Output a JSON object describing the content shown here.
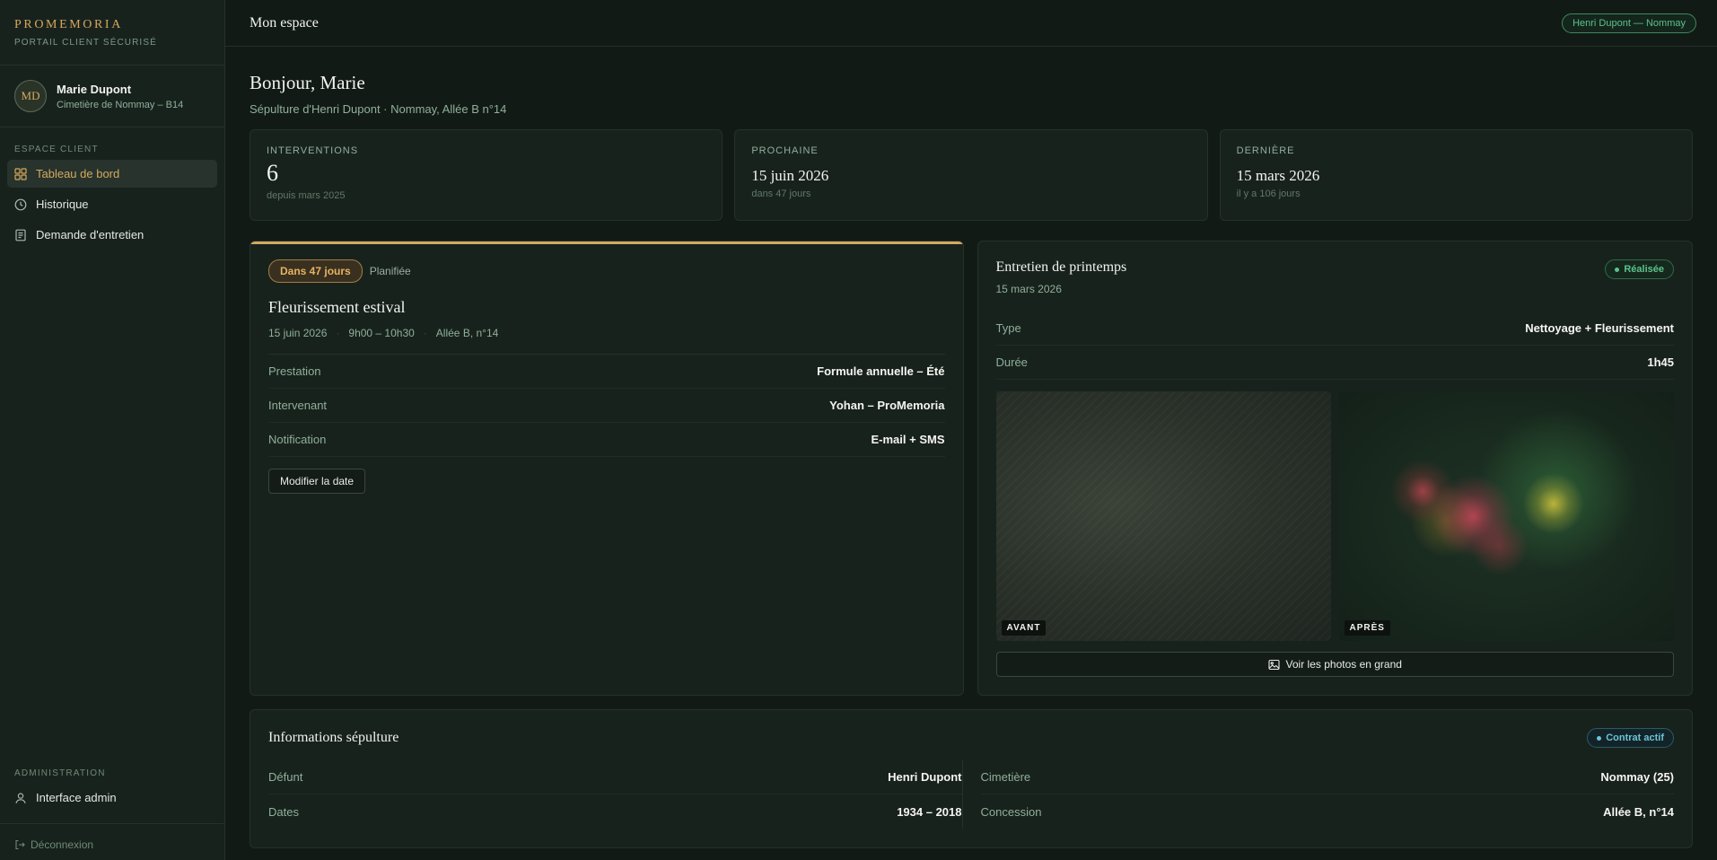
{
  "sidebar": {
    "brand": "PROMEMORIA",
    "brand_sub": "PORTAIL CLIENT SÉCURISÉ",
    "user": {
      "initials": "MD",
      "name": "Marie Dupont",
      "location": "Cimetière de Nommay – B14"
    },
    "section_client": "ESPACE CLIENT",
    "items": [
      {
        "label": "Tableau de bord",
        "icon": "grid-icon",
        "active": true
      },
      {
        "label": "Historique",
        "icon": "clock-icon"
      },
      {
        "label": "Demande d'entretien",
        "icon": "document-icon"
      }
    ],
    "section_admin": "ADMINISTRATION",
    "admin_item": {
      "label": "Interface admin",
      "icon": "user-icon"
    },
    "logout": "Déconnexion"
  },
  "topbar": {
    "title": "Mon espace",
    "badge": "Henri Dupont — Nommay"
  },
  "main": {
    "greeting": "Bonjour, Marie",
    "subtitle": "Sépulture d'Henri Dupont · Nommay, Allée B n°14",
    "stats": [
      {
        "label": "INTERVENTIONS",
        "value": "6",
        "sub": "depuis mars 2025"
      },
      {
        "label": "PROCHAINE",
        "value": "15 juin 2026",
        "sub": "dans 47 jours"
      },
      {
        "label": "DERNIÈRE",
        "value": "15 mars 2026",
        "sub": "il y a 106 jours"
      }
    ]
  },
  "next": {
    "badge": "Dans 47 jours",
    "status": "Planifiée",
    "title": "Fleurissement estival",
    "date": "15 juin 2026",
    "time": "9h00 – 10h30",
    "place": "Allée B, n°14",
    "rows": [
      {
        "k": "Prestation",
        "v": "Formule annuelle – Été"
      },
      {
        "k": "Intervenant",
        "v": "Yohan – ProMemoria"
      },
      {
        "k": "Notification",
        "v": "E-mail + SMS"
      }
    ],
    "button": "Modifier la date"
  },
  "last": {
    "title": "Entretien de printemps",
    "date": "15 mars 2026",
    "badge": "Réalisée",
    "rows": [
      {
        "k": "Type",
        "v": "Nettoyage + Fleurissement"
      },
      {
        "k": "Durée",
        "v": "1h45"
      }
    ],
    "before_label": "AVANT",
    "after_label": "APRÈS",
    "button": "Voir les photos en grand"
  },
  "info": {
    "title": "Informations sépulture",
    "badge": "Contrat actif",
    "left": [
      {
        "k": "Défunt",
        "v": "Henri Dupont"
      },
      {
        "k": "Dates",
        "v": "1934 – 2018"
      }
    ],
    "right": [
      {
        "k": "Cimetière",
        "v": "Nommay (25)"
      },
      {
        "k": "Concession",
        "v": "Allée B, n°14"
      }
    ]
  },
  "colors": {
    "accent": "#d6a85e",
    "success": "#5cc28c",
    "info": "#6cc3d6",
    "background": "#121a16"
  }
}
